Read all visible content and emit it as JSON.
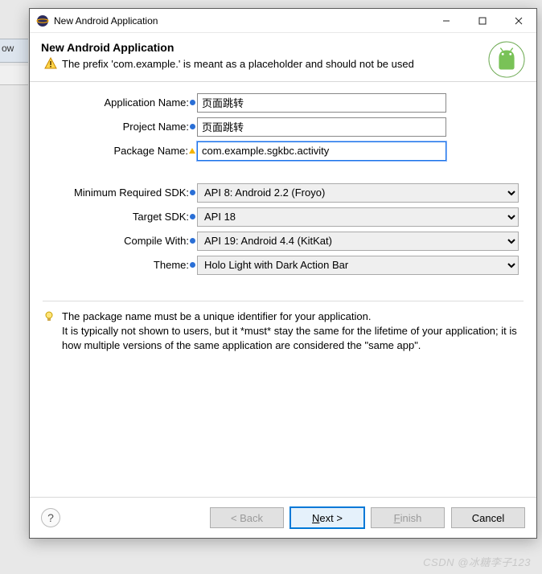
{
  "bg": {
    "strip_text": "ow"
  },
  "titlebar": {
    "title": "New Android Application"
  },
  "header": {
    "heading": "New Android Application",
    "warning": "The prefix 'com.example.' is meant as a placeholder and should not be used"
  },
  "form": {
    "app_name_label": "Application Name:",
    "app_name_value": "页面跳转",
    "project_name_label": "Project Name:",
    "project_name_value": "页面跳转",
    "package_name_label": "Package Name:",
    "package_name_value": "com.example.sgkbc.activity",
    "min_sdk_label": "Minimum Required SDK:",
    "min_sdk_value": "API 8: Android 2.2 (Froyo)",
    "target_sdk_label": "Target SDK:",
    "target_sdk_value": "API 18",
    "compile_label": "Compile With:",
    "compile_value": "API 19: Android 4.4 (KitKat)",
    "theme_label": "Theme:",
    "theme_value": "Holo Light with Dark Action Bar"
  },
  "hint": {
    "text": "The package name must be a unique identifier for your application.\nIt is typically not shown to users, but it *must* stay the same for the lifetime of your application; it is how multiple versions of the same application are considered the \"same app\"."
  },
  "buttons": {
    "back": "< Back",
    "next_prefix": "N",
    "next_rest": "ext >",
    "finish_prefix": "F",
    "finish_rest": "inish",
    "cancel": "Cancel"
  },
  "watermark": "CSDN @冰糖李子123"
}
